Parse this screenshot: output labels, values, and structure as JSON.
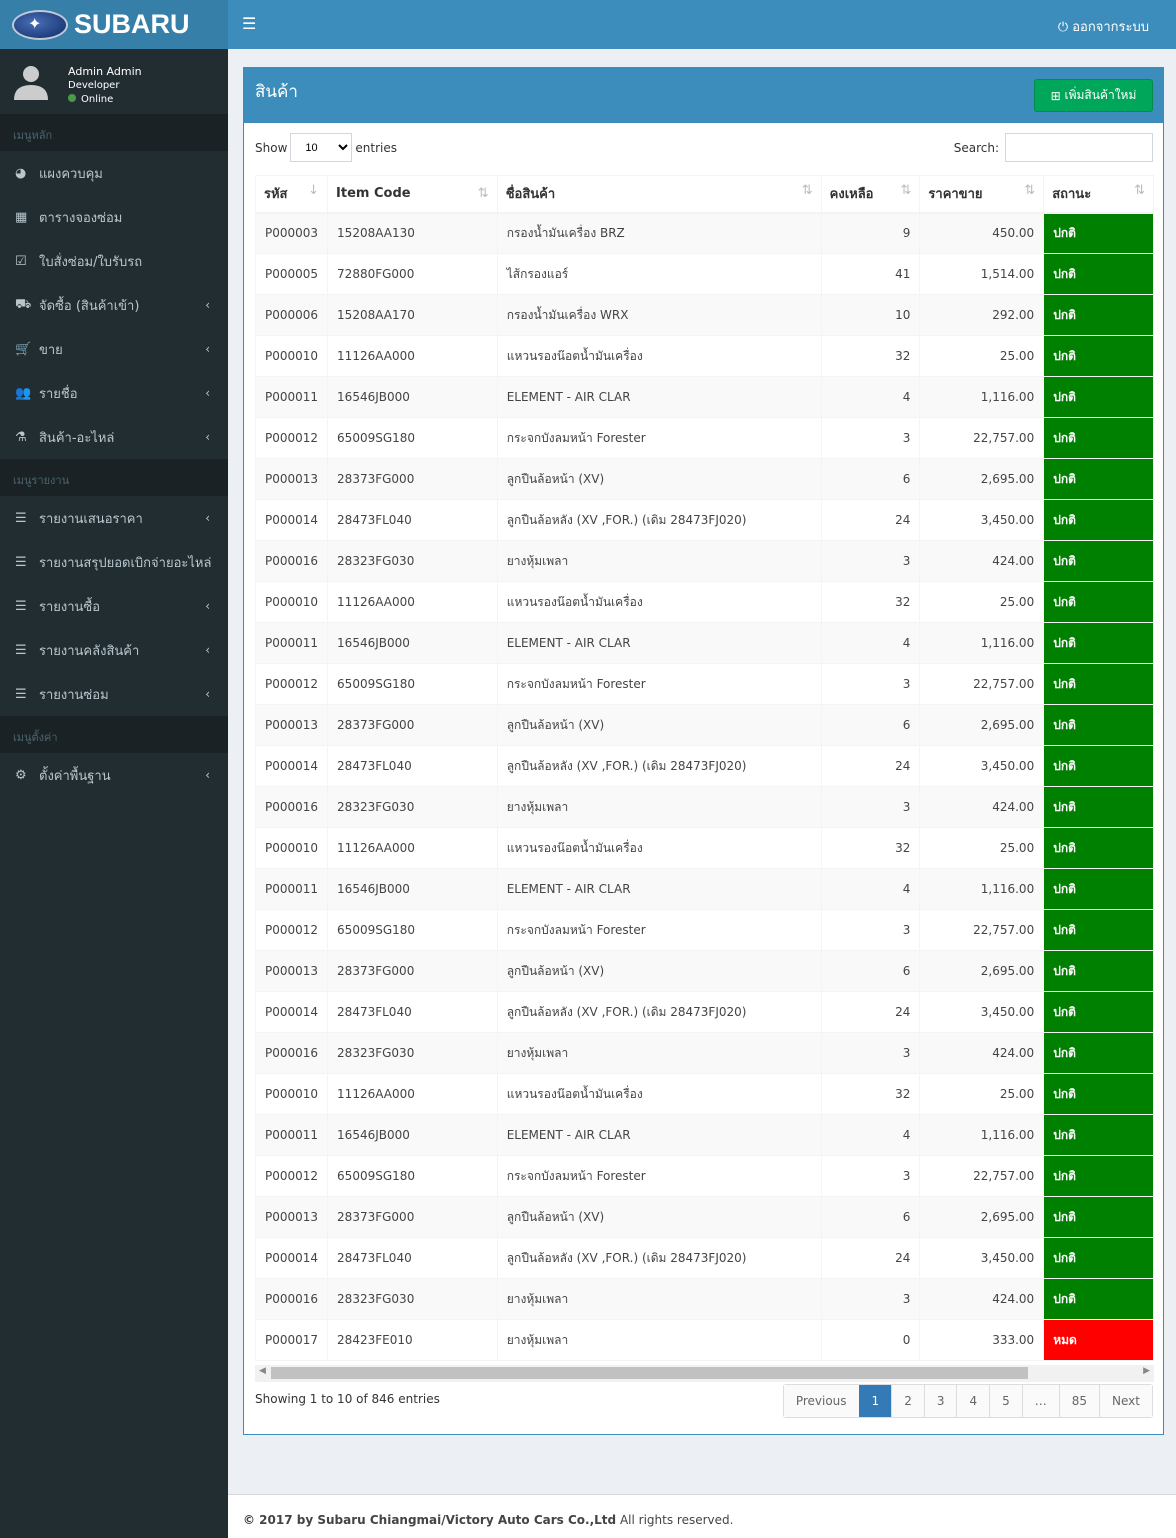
{
  "brand": {
    "logo_text": "SUBARU"
  },
  "topbar": {
    "logout": "ออกจากระบบ"
  },
  "user": {
    "name": "Admin Admin",
    "role": "Developer",
    "status": "Online"
  },
  "sidebar": {
    "main_header": "เมนูหลัก",
    "main_items": [
      {
        "label": "แผงควบคุม",
        "icon": "pie-chart-icon",
        "chev": false
      },
      {
        "label": "ตารางจองซ่อม",
        "icon": "calendar-icon",
        "chev": false
      },
      {
        "label": "ใบสั่งซ่อม/ใบรับรถ",
        "icon": "calendar-check-icon",
        "chev": false
      },
      {
        "label": "จัดซื้อ (สินค้าเข้า)",
        "icon": "truck-icon",
        "chev": true
      },
      {
        "label": "ขาย",
        "icon": "cart-icon",
        "chev": true
      },
      {
        "label": "รายชื่อ",
        "icon": "users-icon",
        "chev": true
      },
      {
        "label": "สินค้า-อะไหล่",
        "icon": "flask-icon",
        "chev": true
      }
    ],
    "report_header": "เมนูรายงาน",
    "report_items": [
      {
        "label": "รายงานเสนอราคา",
        "chev": true
      },
      {
        "label": "รายงานสรุปยอดเบิกจ่ายอะไหล่",
        "chev": false
      },
      {
        "label": "รายงานซื้อ",
        "chev": true
      },
      {
        "label": "รายงานคลังสินค้า",
        "chev": true
      },
      {
        "label": "รายงานซ่อม",
        "chev": true
      }
    ],
    "settings_header": "เมนูตั้งค่า",
    "settings_items": [
      {
        "label": "ตั้งค่าพื้นฐาน",
        "icon": "gears-icon",
        "chev": true
      }
    ]
  },
  "box": {
    "title": "สินค้า",
    "add_button": "เพิ่มสินค้าใหม่"
  },
  "table_controls": {
    "show": "Show",
    "length": "10",
    "entries": "entries",
    "search": "Search:",
    "search_value": ""
  },
  "columns": [
    "รหัส",
    "Item Code",
    "ชื่อสินค้า",
    "คงเหลือ",
    "ราคาขาย",
    "สถานะ"
  ],
  "rows": [
    [
      "P000003",
      "15208AA130",
      "กรองน้ำมันเครื่อง BRZ",
      "9",
      "450.00",
      "ปกติ"
    ],
    [
      "P000005",
      "72880FG000",
      "ไส้กรองแอร์",
      "41",
      "1,514.00",
      "ปกติ"
    ],
    [
      "P000006",
      "15208AA170",
      "กรองน้ำมันเครื่อง WRX",
      "10",
      "292.00",
      "ปกติ"
    ],
    [
      "P000010",
      "11126AA000",
      "แหวนรองน๊อตน้ำมันเครื่อง",
      "32",
      "25.00",
      "ปกติ"
    ],
    [
      "P000011",
      "16546JB000",
      "ELEMENT - AIR CLAR",
      "4",
      "1,116.00",
      "ปกติ"
    ],
    [
      "P000012",
      "65009SG180",
      "กระจกบังลมหน้า Forester",
      "3",
      "22,757.00",
      "ปกติ"
    ],
    [
      "P000013",
      "28373FG000",
      "ลูกปืนล้อหน้า (XV)",
      "6",
      "2,695.00",
      "ปกติ"
    ],
    [
      "P000014",
      "28473FL040",
      "ลูกปืนล้อหลัง (XV ,FOR.) (เดิม 28473FJ020)",
      "24",
      "3,450.00",
      "ปกติ"
    ],
    [
      "P000016",
      "28323FG030",
      "ยางหุ้มเพลา",
      "3",
      "424.00",
      "ปกติ"
    ],
    [
      "P000010",
      "11126AA000",
      "แหวนรองน๊อตน้ำมันเครื่อง",
      "32",
      "25.00",
      "ปกติ"
    ],
    [
      "P000011",
      "16546JB000",
      "ELEMENT - AIR CLAR",
      "4",
      "1,116.00",
      "ปกติ"
    ],
    [
      "P000012",
      "65009SG180",
      "กระจกบังลมหน้า Forester",
      "3",
      "22,757.00",
      "ปกติ"
    ],
    [
      "P000013",
      "28373FG000",
      "ลูกปืนล้อหน้า (XV)",
      "6",
      "2,695.00",
      "ปกติ"
    ],
    [
      "P000014",
      "28473FL040",
      "ลูกปืนล้อหลัง (XV ,FOR.) (เดิม 28473FJ020)",
      "24",
      "3,450.00",
      "ปกติ"
    ],
    [
      "P000016",
      "28323FG030",
      "ยางหุ้มเพลา",
      "3",
      "424.00",
      "ปกติ"
    ],
    [
      "P000010",
      "11126AA000",
      "แหวนรองน๊อตน้ำมันเครื่อง",
      "32",
      "25.00",
      "ปกติ"
    ],
    [
      "P000011",
      "16546JB000",
      "ELEMENT - AIR CLAR",
      "4",
      "1,116.00",
      "ปกติ"
    ],
    [
      "P000012",
      "65009SG180",
      "กระจกบังลมหน้า Forester",
      "3",
      "22,757.00",
      "ปกติ"
    ],
    [
      "P000013",
      "28373FG000",
      "ลูกปืนล้อหน้า (XV)",
      "6",
      "2,695.00",
      "ปกติ"
    ],
    [
      "P000014",
      "28473FL040",
      "ลูกปืนล้อหลัง (XV ,FOR.) (เดิม 28473FJ020)",
      "24",
      "3,450.00",
      "ปกติ"
    ],
    [
      "P000016",
      "28323FG030",
      "ยางหุ้มเพลา",
      "3",
      "424.00",
      "ปกติ"
    ],
    [
      "P000010",
      "11126AA000",
      "แหวนรองน๊อตน้ำมันเครื่อง",
      "32",
      "25.00",
      "ปกติ"
    ],
    [
      "P000011",
      "16546JB000",
      "ELEMENT - AIR CLAR",
      "4",
      "1,116.00",
      "ปกติ"
    ],
    [
      "P000012",
      "65009SG180",
      "กระจกบังลมหน้า Forester",
      "3",
      "22,757.00",
      "ปกติ"
    ],
    [
      "P000013",
      "28373FG000",
      "ลูกปืนล้อหน้า (XV)",
      "6",
      "2,695.00",
      "ปกติ"
    ],
    [
      "P000014",
      "28473FL040",
      "ลูกปืนล้อหลัง (XV ,FOR.) (เดิม 28473FJ020)",
      "24",
      "3,450.00",
      "ปกติ"
    ],
    [
      "P000016",
      "28323FG030",
      "ยางหุ้มเพลา",
      "3",
      "424.00",
      "ปกติ"
    ],
    [
      "P000017",
      "28423FE010",
      "ยางหุ้มเพลา",
      "0",
      "333.00",
      "หมด"
    ]
  ],
  "status_colors": {
    "ปกติ": "#008000",
    "หมด": "#ff0000"
  },
  "info": "Showing 1 to 10 of 846 entries",
  "pagination": [
    "Previous",
    "1",
    "2",
    "3",
    "4",
    "5",
    "…",
    "85",
    "Next"
  ],
  "pagination_active": "1",
  "footer": {
    "copyright": "© 2017 by Subaru Chiangmai/Victory Auto Cars Co.,Ltd",
    "rights": "All rights reserved."
  }
}
